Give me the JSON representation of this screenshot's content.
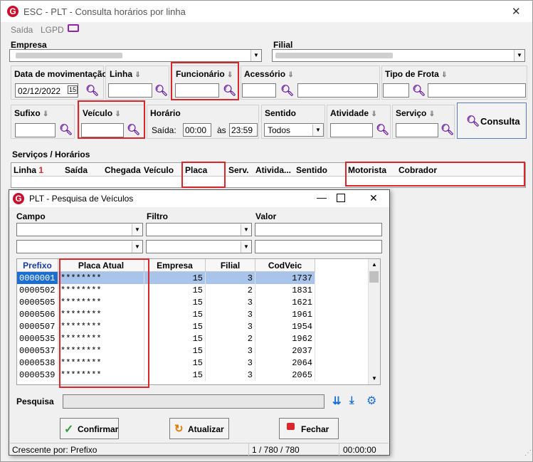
{
  "window": {
    "title": "ESC - PLT - Consulta horários por linha",
    "close": "✕"
  },
  "menu": {
    "saida": "Saída",
    "lgpd": "LGPD"
  },
  "form": {
    "empresa_label": "Empresa",
    "filial_label": "Filial",
    "data_label": "Data de movimentação",
    "data_value": "02/12/2022",
    "data_day": "15",
    "linha_label": "Linha",
    "funcionario_label": "Funcionário",
    "acessorio_label": "Acessório",
    "tipo_frota_label": "Tipo de Frota",
    "sufixo_label": "Sufixo",
    "veiculo_label": "Veículo",
    "horario_label": "Horário",
    "saida_label": "Saída:",
    "saida_value": "00:00",
    "as_label": "às",
    "as_value": "23:59",
    "sentido_label": "Sentido",
    "sentido_value": "Todos",
    "atividade_label": "Atividade",
    "servico_label": "Serviço",
    "consulta_label": "Consulta"
  },
  "services": {
    "title": "Serviços / Horários",
    "columns": [
      "Linha",
      "Saída",
      "Chegada",
      "Veículo",
      "Placa",
      "Serv.",
      "Ativida...",
      "Sentido",
      "Motorista",
      "Cobrador"
    ],
    "sort_mark": "1"
  },
  "dialog": {
    "title": "PLT - Pesquisa de Veículos",
    "campo_label": "Campo",
    "filtro_label": "Filtro",
    "valor_label": "Valor",
    "columns": [
      "Prefixo",
      "Placa Atual",
      "Empresa",
      "Filial",
      "CodVeic"
    ],
    "rows": [
      {
        "prefixo": "0000001",
        "placa": "********",
        "empresa": "15",
        "filial": "3",
        "codveic": "1737"
      },
      {
        "prefixo": "0000502",
        "placa": "********",
        "empresa": "15",
        "filial": "2",
        "codveic": "1831"
      },
      {
        "prefixo": "0000505",
        "placa": "********",
        "empresa": "15",
        "filial": "3",
        "codveic": "1621"
      },
      {
        "prefixo": "0000506",
        "placa": "********",
        "empresa": "15",
        "filial": "3",
        "codveic": "1961"
      },
      {
        "prefixo": "0000507",
        "placa": "********",
        "empresa": "15",
        "filial": "3",
        "codveic": "1954"
      },
      {
        "prefixo": "0000535",
        "placa": "********",
        "empresa": "15",
        "filial": "2",
        "codveic": "1962"
      },
      {
        "prefixo": "0000537",
        "placa": "********",
        "empresa": "15",
        "filial": "3",
        "codveic": "2037"
      },
      {
        "prefixo": "0000538",
        "placa": "********",
        "empresa": "15",
        "filial": "3",
        "codveic": "2064"
      },
      {
        "prefixo": "0000539",
        "placa": "********",
        "empresa": "15",
        "filial": "3",
        "codveic": "2065"
      }
    ],
    "pesquisa_label": "Pesquisa",
    "confirmar": "Confirmar",
    "atualizar": "Atualizar",
    "fechar": "Fechar",
    "status_sort": "Crescente por: Prefixo",
    "status_count": "1 / 780 / 780",
    "status_time": "00:00:00"
  },
  "colors": {
    "accent": "#6a1b9a",
    "highlight": "#d9262c",
    "selected": "#a8c4ea",
    "brand": "#c8102e"
  }
}
